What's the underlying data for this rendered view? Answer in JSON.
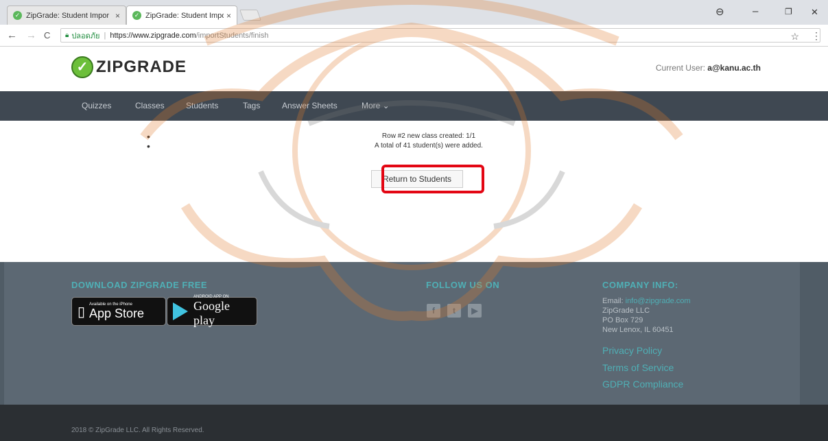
{
  "browser": {
    "tabs": [
      {
        "title": "ZipGrade: Student Impor"
      },
      {
        "title": "ZipGrade: Student Impor"
      }
    ],
    "tab_close": "×",
    "window_controls": {
      "account": "⊖",
      "minimize": "–",
      "maximize": "❐",
      "close": "✕"
    },
    "nav": {
      "back": "←",
      "forward": "→",
      "reload": "C"
    },
    "address": {
      "secure_label": "ปลอดภัย",
      "separator": "|",
      "url_host": "https://www.zipgrade.com",
      "url_path": "/importStudents/finish"
    },
    "bookmark_star": "☆",
    "menu": "⋮"
  },
  "site": {
    "logo_text": "ZIPGRADE",
    "current_user_label": "Current User:",
    "current_user_value": "a@kanu.ac.th",
    "nav": [
      "Quizzes",
      "Classes",
      "Students",
      "Tags",
      "Answer Sheets",
      "More ⌄"
    ]
  },
  "main": {
    "messages": [
      "Row #2 new class created: 1/1",
      "A total of 41 student(s) were added."
    ],
    "return_button": "Return to Students"
  },
  "footer": {
    "download_heading": "DOWNLOAD ZIPGRADE FREE",
    "app_store_small": "Available on the iPhone",
    "app_store_big": "App Store",
    "google_small": "ANDROID APP ON",
    "google_big": "Google play",
    "follow_heading": "FOLLOW US ON",
    "social": [
      "f",
      "t",
      "▶"
    ],
    "company_heading": "COMPANY INFO:",
    "email_label": "Email:",
    "email": "info@zipgrade.com",
    "company_name": "ZipGrade LLC",
    "po_box": "PO Box 729",
    "city": "New Lenox, IL 60451",
    "links": [
      "Privacy Policy",
      "Terms of Service",
      "GDPR Compliance"
    ]
  },
  "copyright": "2018 © ZipGrade LLC. All Rights Reserved."
}
